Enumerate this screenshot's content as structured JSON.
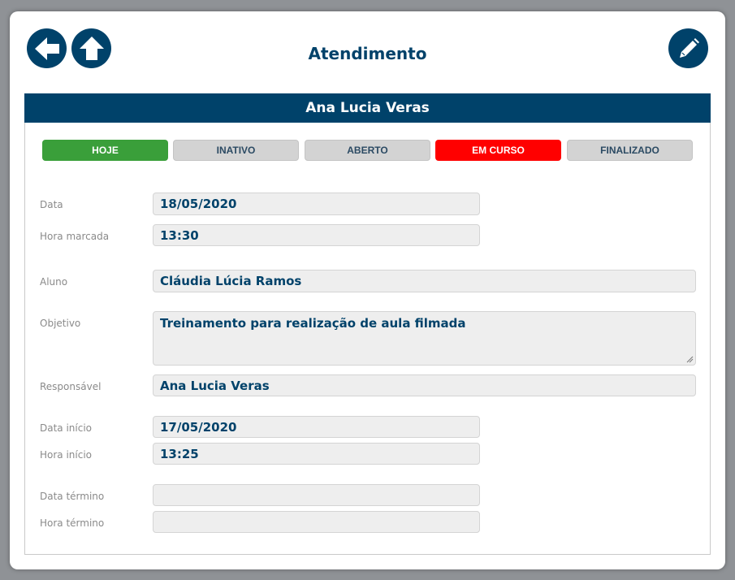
{
  "header": {
    "title": "Atendimento",
    "back_icon": "back-arrow-icon",
    "home_icon": "up-arrow-icon",
    "edit_icon": "pencil-icon"
  },
  "record": {
    "name": "Ana Lucia Veras"
  },
  "status_buttons": [
    {
      "label": "HOJE",
      "color": "#3a9f3a"
    },
    {
      "label": "INATIVO",
      "color": "#d3d3d3"
    },
    {
      "label": "ABERTO",
      "color": "#d3d3d3"
    },
    {
      "label": "EM CURSO",
      "color": "#ff0000"
    },
    {
      "label": "FINALIZADO",
      "color": "#d3d3d3"
    }
  ],
  "fields": {
    "data": {
      "label": "Data",
      "value": "18/05/2020"
    },
    "hora_marcada": {
      "label": "Hora marcada",
      "value": "13:30"
    },
    "aluno": {
      "label": "Aluno",
      "value": "Cláudia Lúcia Ramos"
    },
    "objetivo": {
      "label": "Objetivo",
      "value": "Treinamento para realização de aula filmada"
    },
    "responsavel": {
      "label": "Responsável",
      "value": "Ana Lucia Veras"
    },
    "data_inicio": {
      "label": "Data início",
      "value": "17/05/2020"
    },
    "hora_inicio": {
      "label": "Hora início",
      "value": "13:25"
    },
    "data_termino": {
      "label": "Data término",
      "value": ""
    },
    "hora_termino": {
      "label": "Hora término",
      "value": ""
    }
  },
  "colors": {
    "primary": "#00426a",
    "field_bg": "#eeeeee"
  }
}
